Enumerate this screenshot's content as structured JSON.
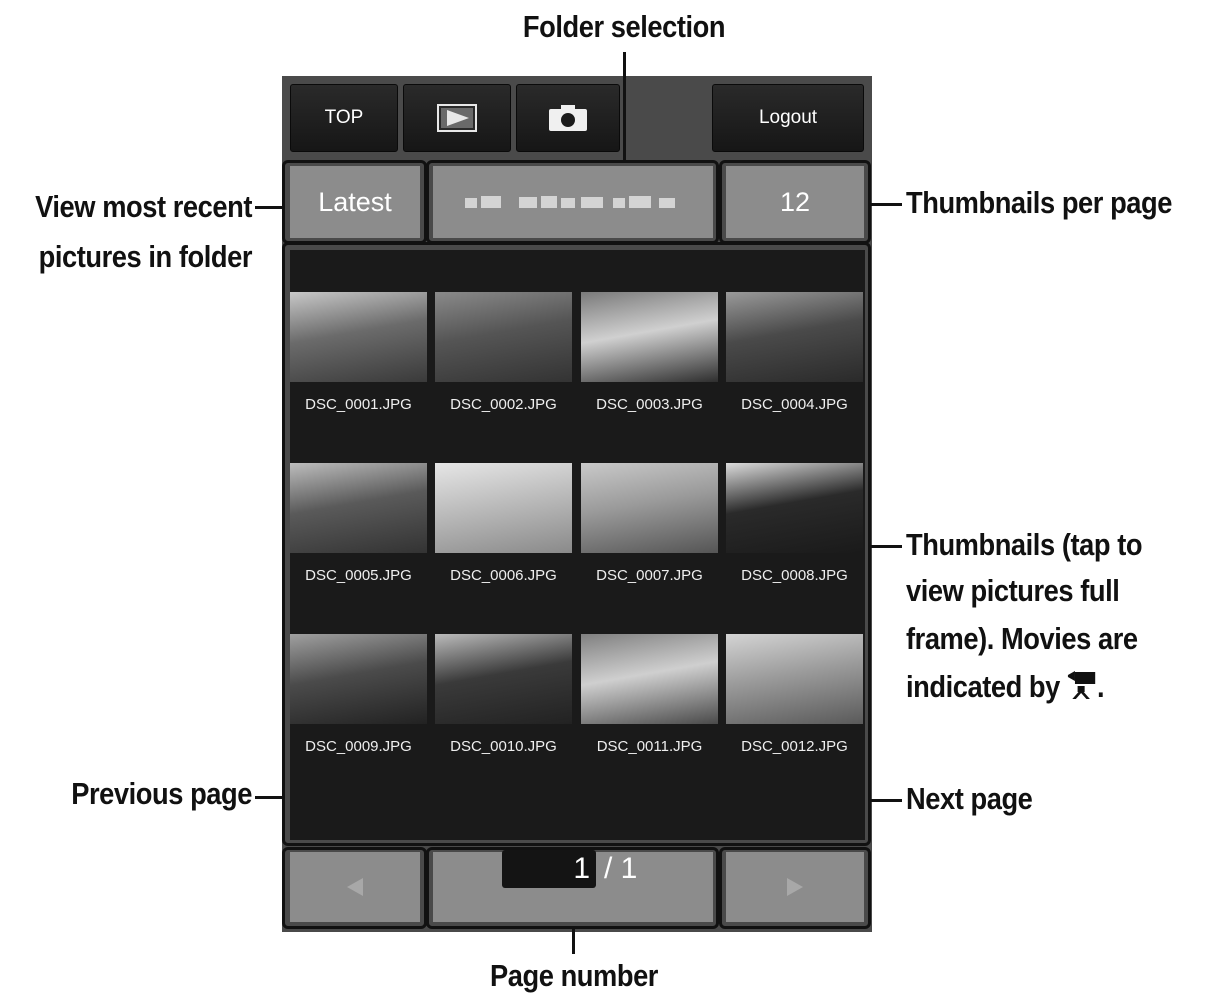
{
  "callouts": {
    "folder_selection": "Folder selection",
    "view_recent_line1": "View most recent",
    "view_recent_line2": "pictures in folder",
    "thumbs_per_page": "Thumbnails per page",
    "thumbnails_line1": "Thumbnails (tap to",
    "thumbnails_line2": "view pictures full",
    "thumbnails_line3": "frame). Movies are",
    "thumbnails_line4": "indicated by",
    "thumbnails_line4_end": ".",
    "previous_page": "Previous page",
    "next_page": "Next page",
    "page_number": "Page number"
  },
  "toolbar": {
    "top_label": "TOP",
    "playback_icon": "playback-icon",
    "camera_icon": "camera-icon",
    "logout_label": "Logout"
  },
  "controls": {
    "latest_label": "Latest",
    "thumbs_per_page_value": "12"
  },
  "thumbnails": [
    {
      "file": "DSC_0001.JPG",
      "colors": [
        "#6b6b6b",
        "#c8c8c8",
        "#3a3a3a"
      ]
    },
    {
      "file": "DSC_0002.JPG",
      "colors": [
        "#555",
        "#8a8a8a",
        "#333"
      ]
    },
    {
      "file": "DSC_0003.JPG",
      "colors": [
        "#d0d0d0",
        "#7a7a7a",
        "#2e2e2e"
      ]
    },
    {
      "file": "DSC_0004.JPG",
      "colors": [
        "#4a4a4a",
        "#9a9a9a",
        "#2a2a2a"
      ]
    },
    {
      "file": "DSC_0005.JPG",
      "colors": [
        "#5a5a5a",
        "#bdbdbd",
        "#333"
      ]
    },
    {
      "file": "DSC_0006.JPG",
      "colors": [
        "#bcbcbc",
        "#e6e6e6",
        "#8a8a8a"
      ]
    },
    {
      "file": "DSC_0007.JPG",
      "colors": [
        "#9a9a9a",
        "#c9c9c9",
        "#555"
      ]
    },
    {
      "file": "DSC_0008.JPG",
      "colors": [
        "#2a2a2a",
        "#dcdcdc",
        "#1a1a1a"
      ]
    },
    {
      "file": "DSC_0009.JPG",
      "colors": [
        "#4b4b4b",
        "#a0a0a0",
        "#222"
      ]
    },
    {
      "file": "DSC_0010.JPG",
      "colors": [
        "#3a3a3a",
        "#bbbbbb",
        "#222"
      ]
    },
    {
      "file": "DSC_0011.JPG",
      "colors": [
        "#cfcfcf",
        "#808080",
        "#4a4a4a"
      ]
    },
    {
      "file": "DSC_0012.JPG",
      "colors": [
        "#9b9b9b",
        "#d4d4d4",
        "#5a5a5a"
      ]
    }
  ],
  "pagination": {
    "current_page": "1",
    "total_label": "/ 1",
    "prev_icon": "triangle-left-icon",
    "next_icon": "triangle-right-icon"
  }
}
